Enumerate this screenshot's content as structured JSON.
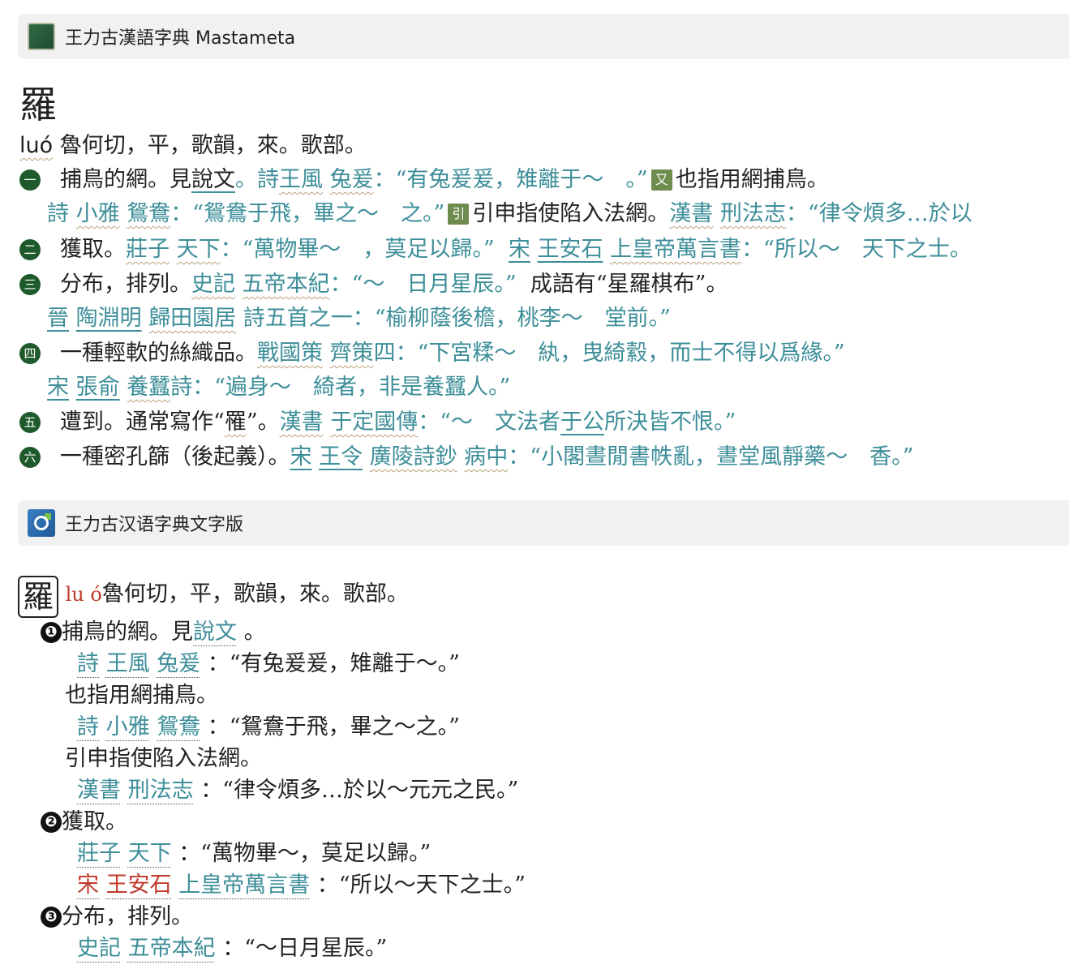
{
  "header1": {
    "title": "王力古漢語字典 Mastameta",
    "icon": "dictionary-book-icon"
  },
  "headword": "羅",
  "entry1": {
    "pinyin": "luó",
    "fanqie": "魯何切，平，歌韻，來。歌部。",
    "badges": [
      "一",
      "二",
      "三",
      "四",
      "五",
      "六"
    ],
    "tags": {
      "you": "又",
      "yin": "引"
    },
    "s1": {
      "def": "捕鳥的網。見",
      "src1": "說文",
      "src2": "。詩",
      "src3": "王風",
      "src4": "兔爰",
      "q": "：“有兔爰爰，雉離于～　。”",
      "def2": "也指用網捕鳥。"
    },
    "s1b": {
      "a": "詩",
      "b": "小雅",
      "c": "鴛鴦",
      "q": "：“鴛鴦于飛，畢之～　之。”",
      "def": "引申指使陷入法網。",
      "d": "漢書",
      "e": "刑法志",
      "q2": "：“律令煩多…於以"
    },
    "s2": {
      "def": "獲取。",
      "a": "莊子",
      "b": "天下",
      "q": "：“萬物畢～　，莫足以歸。”",
      "c": "宋",
      "d": "王安石",
      "e": "上皇帝萬言書",
      "q2": "：“所以～　天下之士。"
    },
    "s3": {
      "def": "分布，排列。",
      "a": "史記",
      "b": "五帝本紀",
      "q": "：“～　日月星辰。”",
      "rest": "成語有“星羅棋布”。"
    },
    "s3b": {
      "a": "晉",
      "b": "陶淵明",
      "c": "歸田園居",
      "d": "詩五首之一：“榆柳蔭後檐，桃李～　堂前。”"
    },
    "s4": {
      "def": "一種輕軟的絲織品。",
      "a": "戰國策",
      "b": "齊策",
      "q": "四：“下宮糅～　紈，曳綺縠，而士不得以爲緣。”"
    },
    "s4b": {
      "a": "宋",
      "b": "張俞",
      "c": "養蠶",
      "q": "詩：“遍身～　綺者，非是養蠶人。”"
    },
    "s5": {
      "def": "遭到。通常寫作“",
      "w": "罹",
      "w2": "”。",
      "a": "漢書",
      "b": "于定國傳",
      "q": "：“～　文法者",
      "c": "于公",
      "q2": "所決皆不恨。”"
    },
    "s6": {
      "def": "一種密孔篩（後起義）。",
      "a": "宋",
      "b": "王令",
      "c": "廣陵詩鈔",
      "d": "病中",
      "q": "：“小閣晝閒書帙亂，晝堂風靜藥～　香。”"
    }
  },
  "header2": {
    "title": "王力古汉语字典文字版",
    "icon": "search-app-icon"
  },
  "entry2": {
    "headword": "羅",
    "pinyin": "lu ó",
    "fanqie": "魯何切，平，歌韻，來。歌部。",
    "nums": [
      "❶",
      "❷",
      "❸"
    ],
    "l1": {
      "a": "捕鳥的網。見",
      "b": "說文",
      "c": " 。"
    },
    "l2": {
      "a": "詩",
      "b": "王風",
      "c": "兔爰",
      "q": "：“有兔爰爰，雉離于～。”"
    },
    "l3": "也指用網捕鳥。",
    "l4": {
      "a": "詩",
      "b": "小雅",
      "c": "鴛鴦",
      "q": "：“鴛鴦于飛，畢之～之。”"
    },
    "l5": "引申指使陷入法網。",
    "l6": {
      "a": "漢書",
      "b": "刑法志",
      "q": "：“律令煩多…於以～元元之民。”"
    },
    "l7": "獲取。",
    "l8": {
      "a": "莊子",
      "b": "天下",
      "q": "：“萬物畢～，莫足以歸。”"
    },
    "l9": {
      "a": "宋",
      "b": "王安石",
      "c": "上皇帝萬言書",
      "q": "：“所以～天下之士。”"
    },
    "l10": "分布，排列。",
    "l11": {
      "a": "史記",
      "b": "五帝本紀",
      "q": "：“～日月星辰。”"
    }
  }
}
